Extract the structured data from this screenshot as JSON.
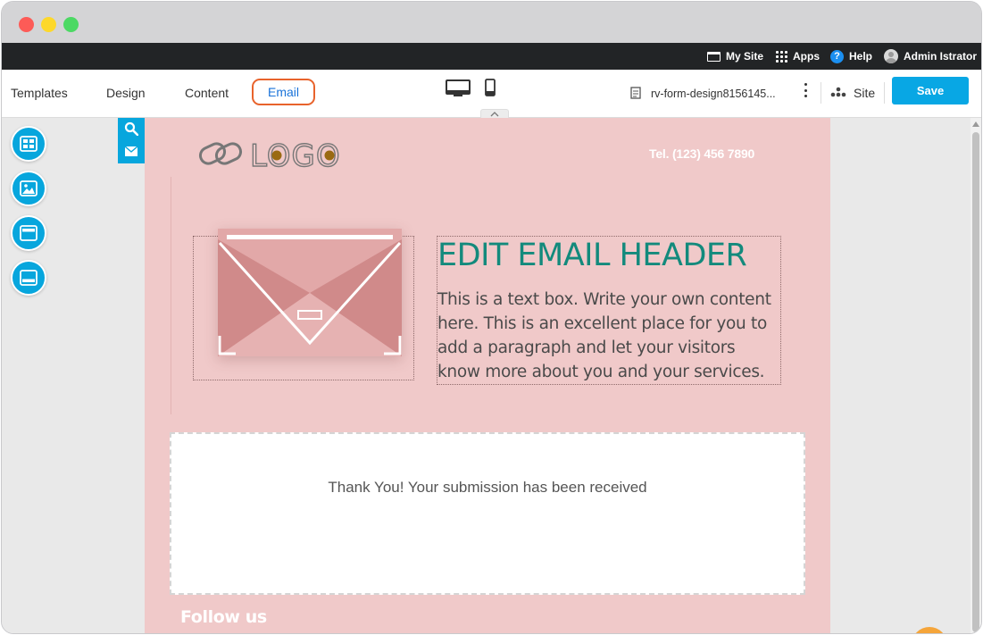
{
  "topbar": {
    "my_site": "My Site",
    "apps": "Apps",
    "help": "Help",
    "user": "Admin Istrator"
  },
  "toolbar": {
    "tabs": [
      "Templates",
      "Design",
      "Content",
      "Email"
    ],
    "active_tab": "Email",
    "document_name": "rv-form-design8156145...",
    "site_label": "Site",
    "save_label": "Save"
  },
  "sidebar": {
    "tools": [
      "layout-icon",
      "image-icon",
      "header-section-icon",
      "footer-section-icon"
    ]
  },
  "email": {
    "logo_text": "LOGO",
    "phone": "Tel. (123) 456 7890",
    "header": "EDIT EMAIL HEADER",
    "body": "This is a text box. Write your own content here. This is an excellent place for you to add a paragraph and let your visitors know more about you and your services.",
    "thank_you": "Thank You! Your submission has been received",
    "follow": "Follow us"
  },
  "colors": {
    "accent": "#07a6dd",
    "canvas_bg": "#f0c9c9",
    "header_text": "#138a7c",
    "active_tab_border": "#e8632c",
    "active_tab_text": "#1a73d9"
  }
}
